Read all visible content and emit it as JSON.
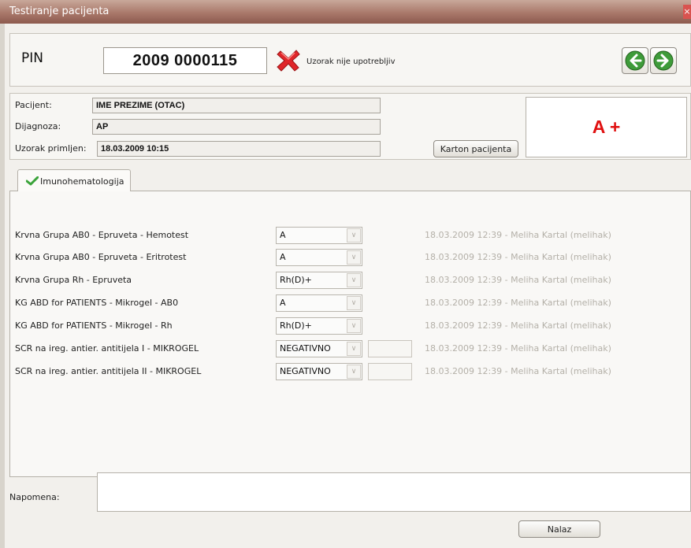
{
  "window": {
    "title": "Testiranje pacijenta",
    "close_glyph": "×"
  },
  "header": {
    "pin_label": "PIN",
    "pin_value": "2009 0000115",
    "status_icon": "red-x-icon",
    "status_text": "Uzorak nije upotrebljiv",
    "nav_back_icon": "arrow-left-icon",
    "nav_forward_icon": "arrow-right-icon"
  },
  "patient": {
    "name_label": "Pacijent:",
    "name_value": "IME PREZIME (OTAC)",
    "diagnosis_label": "Dijagnoza:",
    "diagnosis_value": "AP",
    "received_label": "Uzorak primljen:",
    "received_value": "18.03.2009 10:15",
    "card_button": "Karton pacijenta",
    "blood_type": "A +"
  },
  "tabs": [
    {
      "label": "Imunohematologija",
      "icon": "checkmark-icon"
    }
  ],
  "tests": [
    {
      "name": "Krvna Grupa AB0 - Epruveta - Hemotest",
      "value": "A",
      "meta": "18.03.2009 12:39  -  Meliha Kartal (melihak)"
    },
    {
      "name": "Krvna Grupa AB0 - Epruveta - Eritrotest",
      "value": "A",
      "meta": "18.03.2009 12:39  -  Meliha Kartal (melihak)"
    },
    {
      "name": "Krvna Grupa Rh - Epruveta",
      "value": "Rh(D)+",
      "meta": "18.03.2009 12:39  -  Meliha Kartal (melihak)"
    },
    {
      "name": "KG ABD for PATIENTS - Mikrogel - AB0",
      "value": "A",
      "meta": "18.03.2009 12:39  -  Meliha Kartal (melihak)"
    },
    {
      "name": "KG ABD for PATIENTS - Mikrogel - Rh",
      "value": "Rh(D)+",
      "meta": "18.03.2009 12:39  -  Meliha Kartal (melihak)"
    },
    {
      "name": "SCR na ireg. antier. antitijela I - MIKROGEL",
      "value": "NEGATIVNO",
      "meta": "18.03.2009 12:39  -  Meliha Kartal (melihak)"
    },
    {
      "name": "SCR na ireg. antier. antitijela II - MIKROGEL",
      "value": "NEGATIVNO",
      "meta": "18.03.2009 12:39  -  Meliha Kartal (melihak)"
    }
  ],
  "dropdown_glyph": "∨",
  "footer": {
    "note_label": "Napomena:",
    "note_value": "",
    "result_button": "Nalaz"
  },
  "colors": {
    "blood_type": "#e01010",
    "meta_text": "#b4b0a8",
    "title_bar": "#a9786a"
  }
}
